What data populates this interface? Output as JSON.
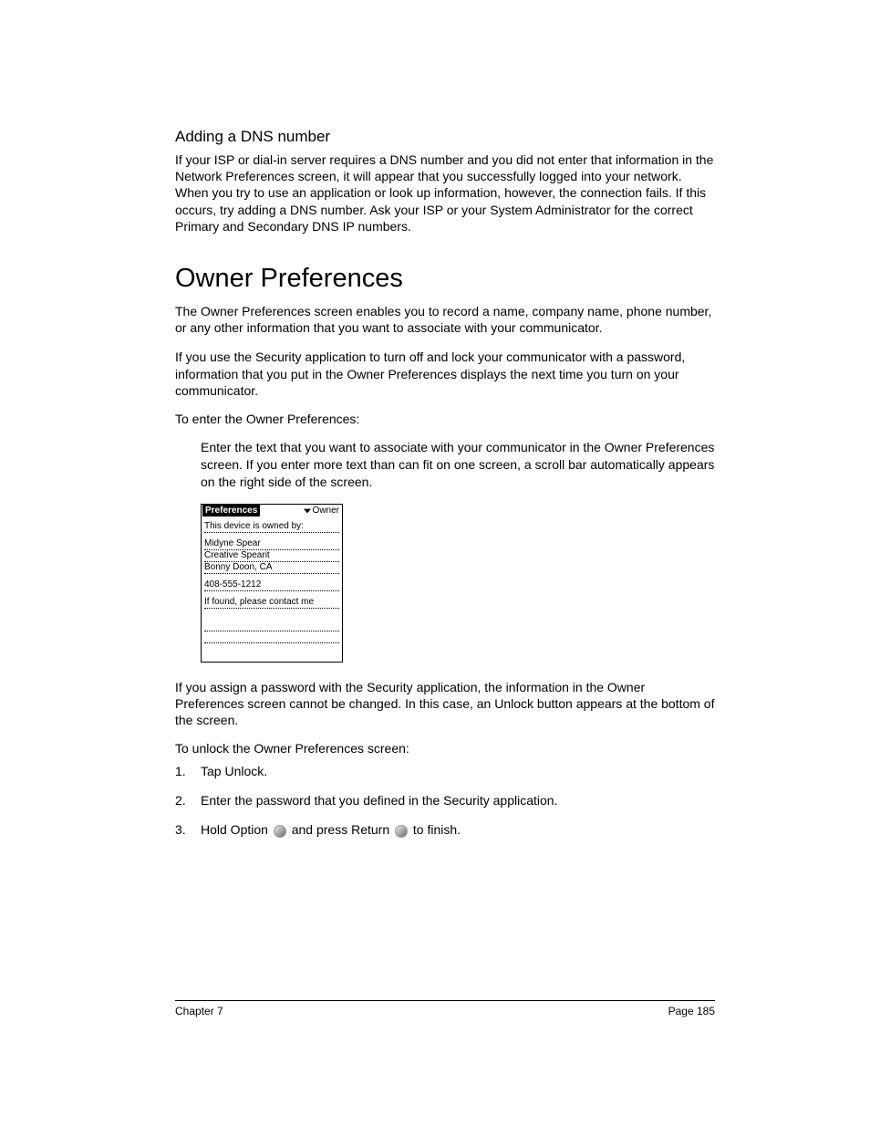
{
  "section1": {
    "heading": "Adding a DNS number",
    "body": "If your ISP or dial-in server requires a DNS number and you did not enter that information in the Network Preferences screen, it will appear that you successfully logged into your network. When you try to use an application or look up information, however, the connection fails. If this occurs, try adding a DNS number. Ask your ISP or your System Administrator for the correct Primary and Secondary DNS IP numbers."
  },
  "section2": {
    "heading": "Owner Preferences",
    "para1": "The Owner Preferences screen enables you to record a name, company name, phone number, or any other information that you want to associate with your communicator.",
    "para2": "If you use the Security application to turn off and lock your communicator with a password, information that you put in the Owner Preferences displays the next time you turn on your communicator.",
    "enter_heading": "To enter the Owner Preferences:",
    "enter_body": "Enter the text that you want to associate with your communicator in the Owner Preferences screen. If you enter more text than can fit on one screen, a scroll bar automatically appears on the right side of the screen.",
    "after_fig": "If you assign a password with the Security application, the information in the Owner Preferences screen cannot be changed. In this case, an Unlock button appears at the bottom of the screen.",
    "unlock_heading": "To unlock the Owner Preferences screen:",
    "steps": {
      "s1_num": "1.",
      "s1_text": "Tap Unlock.",
      "s2_num": "2.",
      "s2_text": "Enter the password that you defined in the Security application.",
      "s3_num": "3.",
      "s3_a": "Hold Option ",
      "s3_b": " and press Return ",
      "s3_c": " to finish."
    }
  },
  "prefs_ui": {
    "title": "Preferences",
    "dropdown": "Owner",
    "lines": [
      "This device is owned by:",
      "",
      "Midyne Spear",
      "Creative Spearit",
      "Bonny Doon, CA",
      "",
      "408-555-1212",
      "",
      "If found, please contact me",
      "",
      ""
    ]
  },
  "footer": {
    "left": "Chapter 7",
    "right": "Page 185"
  }
}
